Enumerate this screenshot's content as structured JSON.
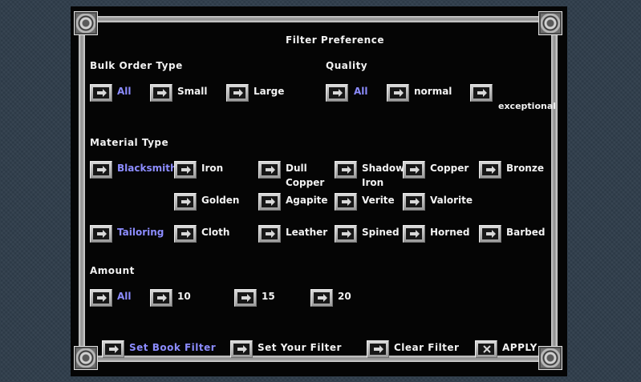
{
  "title": "Filter Preference",
  "bulk_order_type": {
    "heading": "Bulk Order Type",
    "options": {
      "all": "All",
      "small": "Small",
      "large": "Large"
    }
  },
  "quality": {
    "heading": "Quality",
    "options": {
      "all": "All",
      "normal": "normal",
      "exceptional": "exceptional"
    }
  },
  "material_type": {
    "heading": "Material Type",
    "blacksmithy": {
      "label": "Blacksmithy",
      "iron": "Iron",
      "dull_copper_1": "Dull",
      "dull_copper_2": "Copper",
      "shadow_iron_1": "Shadow",
      "shadow_iron_2": "Iron",
      "copper": "Copper",
      "bronze": "Bronze",
      "golden": "Golden",
      "agapite": "Agapite",
      "verite": "Verite",
      "valorite": "Valorite"
    },
    "tailoring": {
      "label": "Tailoring",
      "cloth": "Cloth",
      "leather": "Leather",
      "spined": "Spined",
      "horned": "Horned",
      "barbed": "Barbed"
    }
  },
  "amount": {
    "heading": "Amount",
    "options": {
      "all": "All",
      "ten": "10",
      "fifteen": "15",
      "twenty": "20"
    }
  },
  "footer": {
    "set_book_filter": "Set Book Filter",
    "set_your_filter": "Set Your Filter",
    "clear_filter": "Clear Filter",
    "apply": "APPLY"
  },
  "colors": {
    "selected_text": "#8c8cff",
    "normal_text": "#f2f2f2",
    "gump_background": "#050505",
    "desktop_background": "#2f3d4b"
  },
  "icons": {
    "option_button": "arrow-right-icon",
    "apply_button": "x-icon",
    "corners": "knot-ornament-icon"
  }
}
